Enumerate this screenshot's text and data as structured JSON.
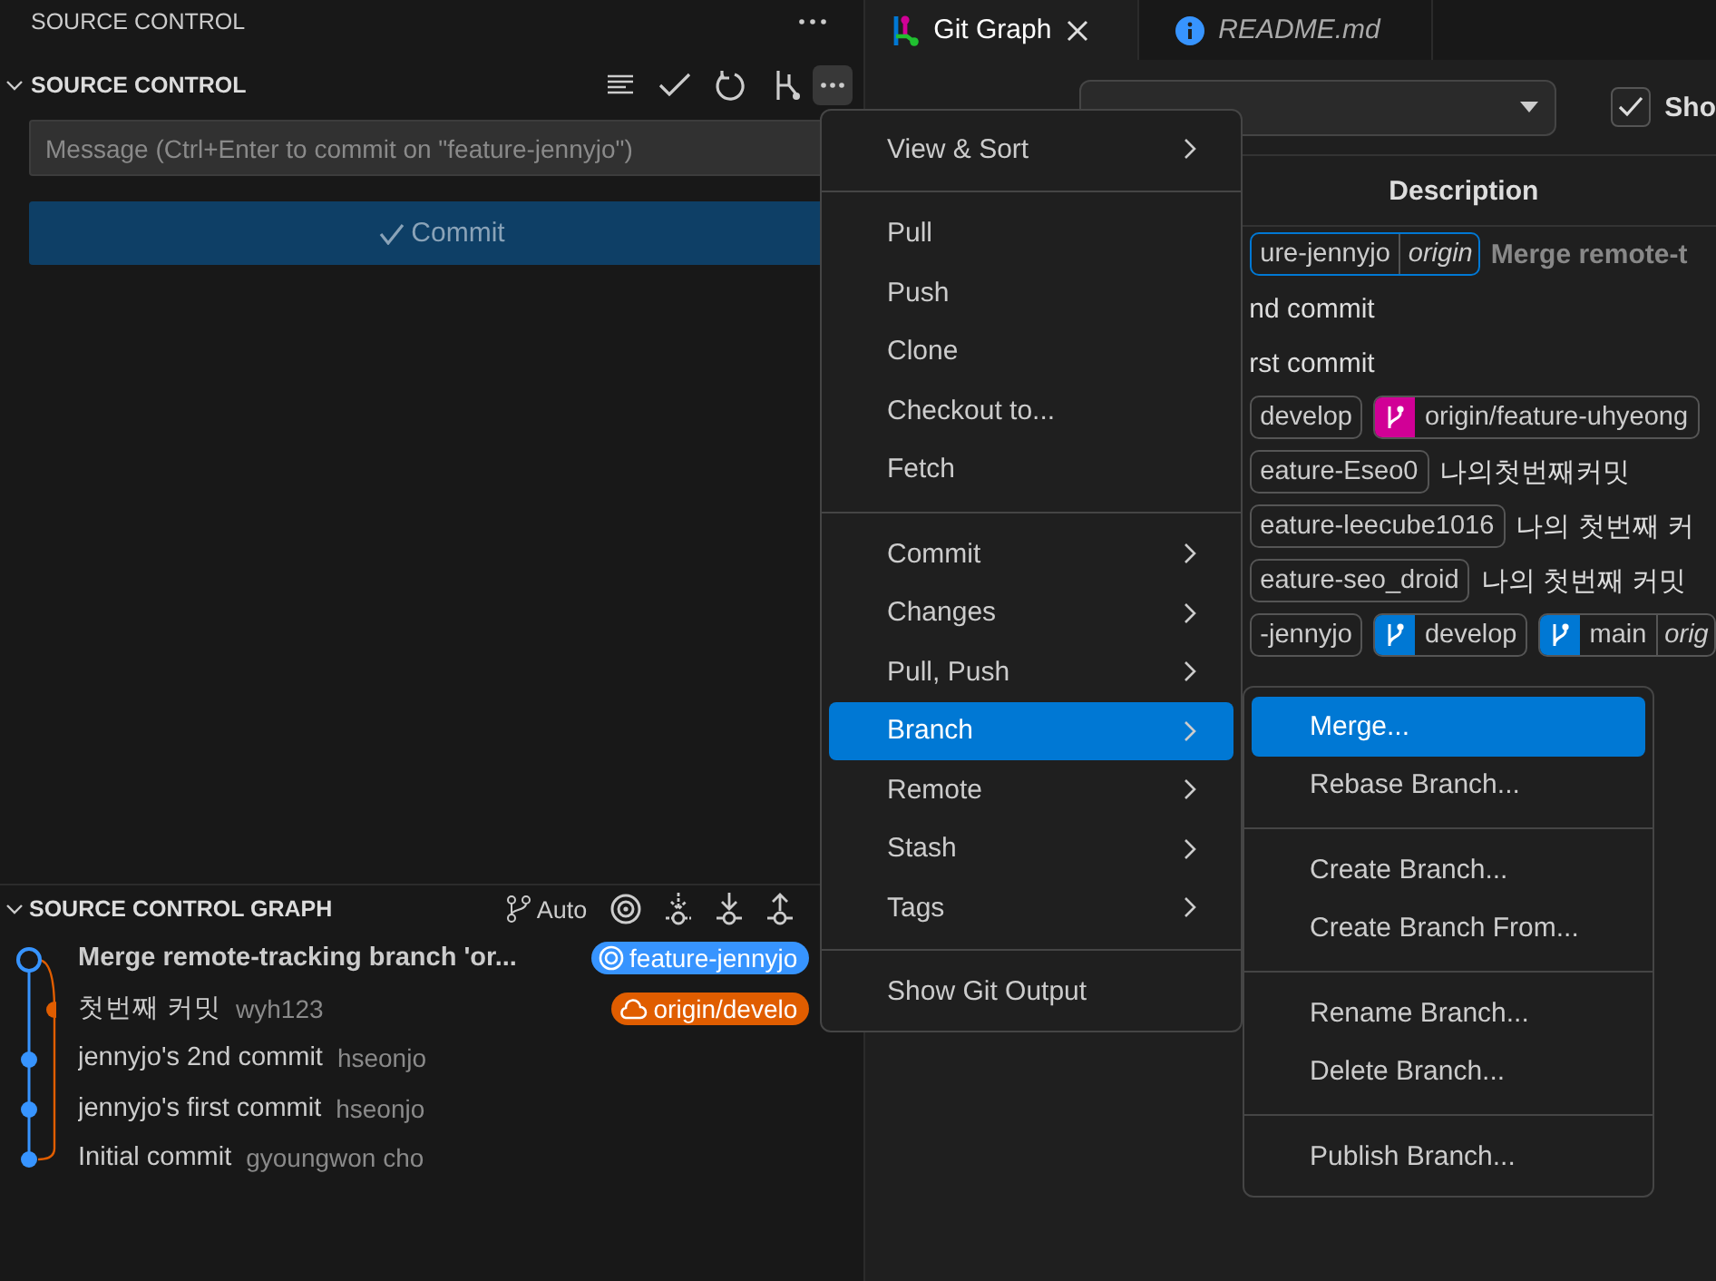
{
  "sidebar": {
    "title": "SOURCE CONTROL"
  },
  "scm": {
    "title": "SOURCE CONTROL",
    "expanded": true,
    "message_placeholder": "Message (Ctrl+Enter to commit on \"feature-jennyjo\")",
    "commit_button": "Commit"
  },
  "graph": {
    "title": "SOURCE CONTROL GRAPH",
    "expanded": true,
    "mode": "Auto",
    "commits": [
      {
        "kind": "merge",
        "message": "Merge remote-tracking branch 'or...",
        "refs": [
          {
            "kind": "local",
            "label": "feature-jennyjo",
            "color": "#3794ff"
          }
        ]
      },
      {
        "kind": "side",
        "message": "첫번째 커밋",
        "author": "wyh123",
        "refs": [
          {
            "kind": "remote",
            "label": "origin/develo",
            "color": "#e05d00"
          }
        ]
      },
      {
        "kind": "main",
        "message": "jennyjo's 2nd commit",
        "author": "hseonjo"
      },
      {
        "kind": "main",
        "message": "jennyjo's first commit",
        "author": "hseonjo"
      },
      {
        "kind": "main",
        "message": "Initial commit",
        "author": "gyoungwon cho"
      }
    ]
  },
  "editor": {
    "tabs": [
      {
        "kind": "graph",
        "label": "Git Graph",
        "selected": true
      },
      {
        "kind": "info",
        "label": "README.md",
        "selected": false
      }
    ],
    "show_checkbox": {
      "label": "Sho",
      "checked": true
    },
    "column": "Description",
    "rows": [
      {
        "current": true,
        "message": "Merge remote-t",
        "refs": [
          {
            "kind": "fragment",
            "label": "ure-jennyjo",
            "remote": "origin"
          }
        ]
      },
      {
        "current": false,
        "message": "nd commit"
      },
      {
        "current": false,
        "message": "rst commit"
      },
      {
        "current": false,
        "refs": [
          {
            "kind": "fragment",
            "label": "develop"
          },
          {
            "kind": "branch",
            "label": "origin/feature-uhyeong",
            "color": "#d10096"
          }
        ]
      },
      {
        "current": false,
        "message": "나의첫번째커밋",
        "refs": [
          {
            "kind": "fragment",
            "label": "eature-Eseo0"
          }
        ]
      },
      {
        "current": false,
        "message": "나의 첫번째 커",
        "refs": [
          {
            "kind": "fragment",
            "label": "eature-leecube1016"
          }
        ]
      },
      {
        "current": false,
        "message": "나의 첫번째 커밋",
        "refs": [
          {
            "kind": "fragment",
            "label": "eature-seo_droid"
          }
        ]
      },
      {
        "current": false,
        "refs": [
          {
            "kind": "fragment",
            "label": "-jennyjo"
          },
          {
            "kind": "branch",
            "label": "develop",
            "color": "#0078d4"
          },
          {
            "kind": "branch",
            "label": "main",
            "color": "#0078d4",
            "remote": "orig"
          }
        ]
      }
    ]
  },
  "menu": {
    "items": [
      {
        "kind": "submenu",
        "label": "View & Sort",
        "selected": false
      },
      {
        "kind": "separator"
      },
      {
        "kind": "item",
        "label": "Pull",
        "selected": false
      },
      {
        "kind": "item",
        "label": "Push",
        "selected": false
      },
      {
        "kind": "item",
        "label": "Clone",
        "selected": false
      },
      {
        "kind": "item",
        "label": "Checkout to...",
        "selected": false
      },
      {
        "kind": "item",
        "label": "Fetch",
        "selected": false
      },
      {
        "kind": "separator"
      },
      {
        "kind": "submenu",
        "label": "Commit",
        "selected": false
      },
      {
        "kind": "submenu",
        "label": "Changes",
        "selected": false
      },
      {
        "kind": "submenu",
        "label": "Pull, Push",
        "selected": false
      },
      {
        "kind": "submenu",
        "label": "Branch",
        "selected": true
      },
      {
        "kind": "submenu",
        "label": "Remote",
        "selected": false
      },
      {
        "kind": "submenu",
        "label": "Stash",
        "selected": false
      },
      {
        "kind": "submenu",
        "label": "Tags",
        "selected": false
      },
      {
        "kind": "separator"
      },
      {
        "kind": "item",
        "label": "Show Git Output",
        "selected": false
      }
    ]
  },
  "submenu": {
    "items": [
      {
        "kind": "item",
        "label": "Merge...",
        "selected": true
      },
      {
        "kind": "item",
        "label": "Rebase Branch...",
        "selected": false
      },
      {
        "kind": "separator"
      },
      {
        "kind": "item",
        "label": "Create Branch...",
        "selected": false
      },
      {
        "kind": "item",
        "label": "Create Branch From...",
        "selected": false
      },
      {
        "kind": "separator"
      },
      {
        "kind": "item",
        "label": "Rename Branch...",
        "selected": false
      },
      {
        "kind": "item",
        "label": "Delete Branch...",
        "selected": false
      },
      {
        "kind": "separator"
      },
      {
        "kind": "item",
        "label": "Publish Branch...",
        "selected": false
      }
    ]
  }
}
